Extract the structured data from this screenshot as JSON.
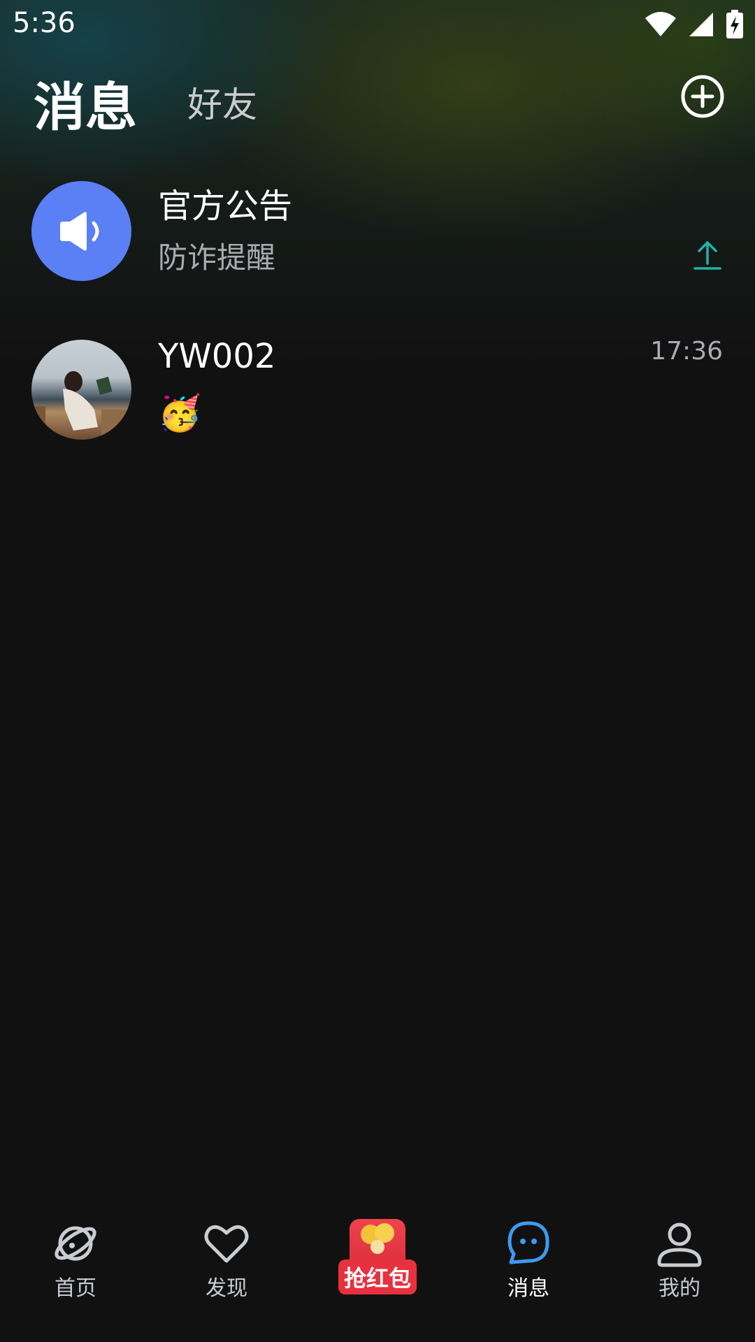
{
  "status_bar": {
    "time": "5:36",
    "icons": [
      "wifi-icon",
      "signal-icon",
      "battery-charging-icon"
    ]
  },
  "header": {
    "tabs": [
      {
        "label": "消息",
        "active": true
      },
      {
        "label": "好友",
        "active": false
      }
    ],
    "add_icon": "plus-circle-icon"
  },
  "conversations": [
    {
      "name": "官方公告",
      "preview": "防诈提醒",
      "avatar_icon": "speaker-icon",
      "avatar_color": "#5b7ff5",
      "pinned_icon": "pin-up-icon",
      "pin_color": "#1fb5a6"
    },
    {
      "name": "YW002",
      "preview": "🥳",
      "time": "17:36",
      "avatar": "photo"
    }
  ],
  "bottom_nav": {
    "items": [
      {
        "label": "首页",
        "icon": "planet-icon",
        "active": false
      },
      {
        "label": "发现",
        "icon": "heart-icon",
        "active": false
      },
      {
        "label": "抢红包",
        "icon": "red-packet-icon",
        "active": false
      },
      {
        "label": "消息",
        "icon": "chat-bubble-icon",
        "active": true
      },
      {
        "label": "我的",
        "icon": "person-icon",
        "active": false
      }
    ],
    "active_color": "#3d9bf0"
  }
}
